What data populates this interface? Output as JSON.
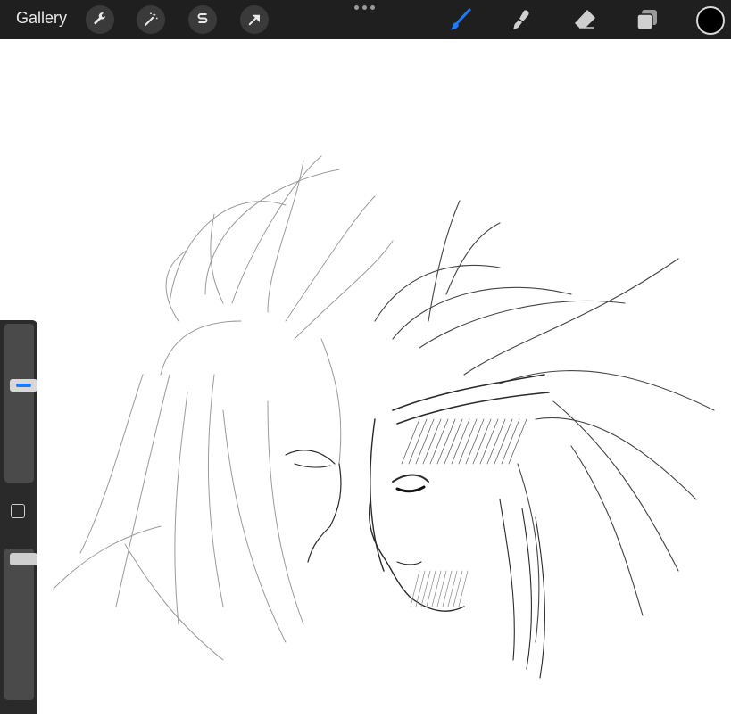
{
  "topbar": {
    "gallery_label": "Gallery",
    "tools": [
      {
        "name": "wrench-icon"
      },
      {
        "name": "magic-wand-icon"
      },
      {
        "name": "selection-icon"
      },
      {
        "name": "transform-arrow-icon"
      }
    ],
    "more_menu_icon": "ellipsis-icon",
    "right_tools": [
      {
        "name": "brush-icon",
        "active": true
      },
      {
        "name": "smudge-icon",
        "active": false
      },
      {
        "name": "eraser-icon",
        "active": false
      },
      {
        "name": "layers-icon",
        "active": false
      }
    ],
    "current_color": "#000000"
  },
  "sidebar": {
    "brush_size": 0.62,
    "brush_opacity": 0.97
  },
  "colors": {
    "toolbar_bg": "#1f1f1f",
    "active_tool": "#1e7bff"
  }
}
